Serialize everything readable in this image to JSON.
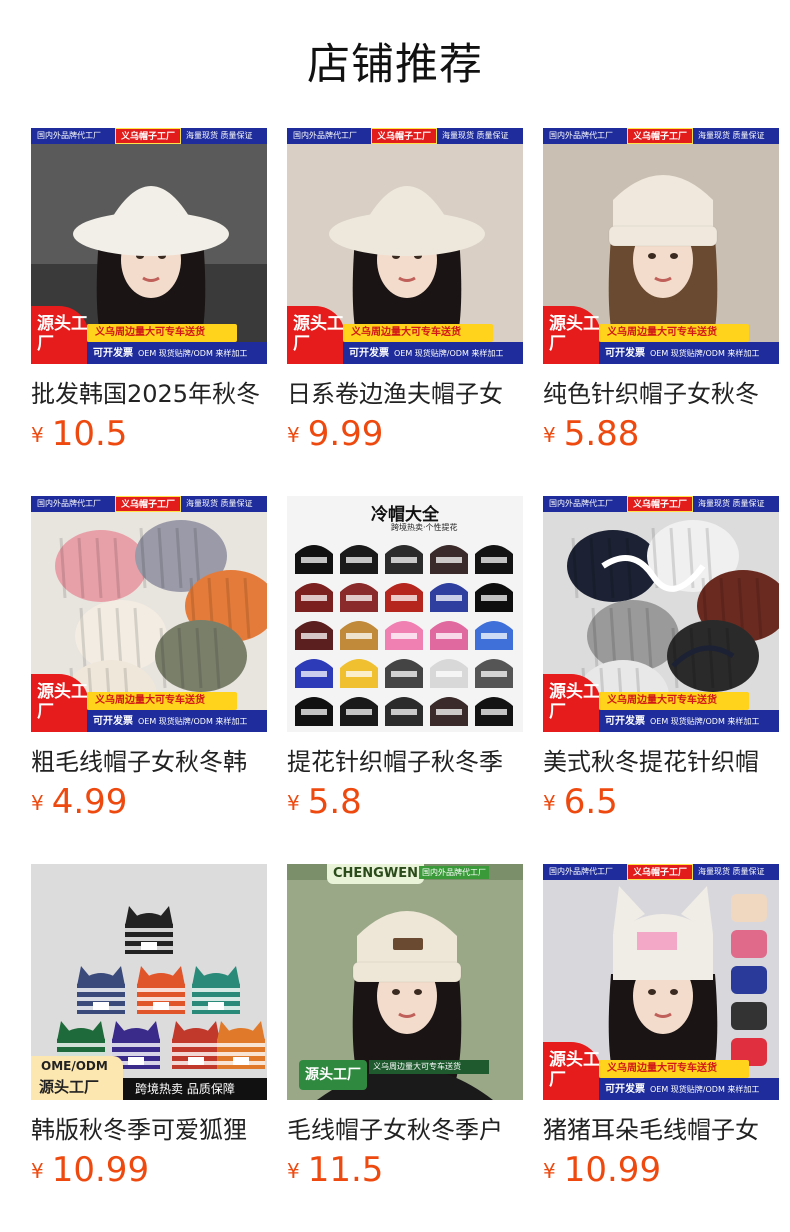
{
  "header": {
    "title": "店铺推荐"
  },
  "currency": "¥",
  "products": [
    {
      "name": "批发韩国2025年秋冬",
      "price": "10.5",
      "banner": {
        "top_left": "国内外品牌代工厂",
        "top_mid": "义乌帽子工厂",
        "top_right": "海量现货 质量保证",
        "badge": "源头工厂",
        "yellow": "义乌周边量大可专车送货",
        "blue_main": "可开发票",
        "blue_sub": "OEM 现货贴牌/ODM 来样加工"
      },
      "hat_color": "#f2efe8",
      "bg": "#3a3a3a",
      "image_icon": "white-bucket-hat-photo"
    },
    {
      "name": "日系卷边渔夫帽子女",
      "price": "9.99",
      "banner": {
        "top_left": "国内外品牌代工厂",
        "top_mid": "义乌帽子工厂",
        "top_right": "海量现货 质量保证",
        "badge": "源头工厂",
        "yellow": "义乌周边量大可专车送货",
        "blue_main": "可开发票",
        "blue_sub": "OEM 现货贴牌/ODM 来样加工"
      },
      "hat_color": "#eee8dc",
      "bg": "#d9cfc4",
      "image_icon": "fleece-bucket-hat-photo"
    },
    {
      "name": "纯色针织帽子女秋冬",
      "price": "5.88",
      "banner": {
        "top_left": "国内外品牌代工厂",
        "top_mid": "义乌帽子工厂",
        "top_right": "海量现货 质量保证",
        "badge": "源头工厂",
        "yellow": "义乌周边量大可专车送货",
        "blue_main": "可开发票",
        "blue_sub": "OEM 现货贴牌/ODM 来样加工"
      },
      "hat_color": "#f0e8dc",
      "bg": "#c9bfb2",
      "image_icon": "beanie-model-photo"
    },
    {
      "name": "粗毛线帽子女秋冬韩",
      "price": "4.99",
      "banner": {
        "top_left": "国内外品牌代工厂",
        "top_mid": "义乌帽子工厂",
        "top_right": "海量现货 质量保证",
        "badge": "源头工厂",
        "yellow": "义乌周边量大可专车送货",
        "blue_main": "可开发票",
        "blue_sub": "OEM 现货贴牌/ODM 来样加工"
      },
      "hat_color": "#e47b3a",
      "bg": "#e8e4de",
      "image_icon": "chunky-beanies-photo"
    },
    {
      "name": "提花针织帽子秋冬季",
      "price": "5.8",
      "banner": null,
      "overlay_title": "冷帽大全",
      "overlay_sub": "跨境热卖·个性提花",
      "hat_color": "#222222",
      "bg": "#f4f4f4",
      "image_icon": "jacquard-beanies-grid"
    },
    {
      "name": "美式秋冬提花针织帽",
      "price": "6.5",
      "banner": {
        "top_left": "国内外品牌代工厂",
        "top_mid": "义乌帽子工厂",
        "top_right": "海量现货 质量保证",
        "badge": "源头工厂",
        "yellow": "义乌周边量大可专车送货",
        "blue_main": "可开发票",
        "blue_sub": "OEM 现货贴牌/ODM 来样加工"
      },
      "hat_color": "#1c2233",
      "bg": "#dcdcdc",
      "image_icon": "star-beanies-photo"
    },
    {
      "name": "韩版秋冬季可爱狐狸",
      "price": "10.99",
      "banner": null,
      "overlay_title": "OME/ODM",
      "overlay_sub": "源头工厂",
      "overlay_strip": "跨境热卖 品质保障",
      "hat_color": "#1f1f1f",
      "bg": "#dcdcdc",
      "image_icon": "fox-ear-beanies-photo"
    },
    {
      "name": "毛线帽子女秋冬季户",
      "price": "11.5",
      "banner": null,
      "overlay_title": "CHENGWEN",
      "overlay_sub": "国内外品牌代工厂",
      "overlay_strip": "义乌周边量大可专车送货",
      "badge2": "源头工厂",
      "hat_color": "#eee6d6",
      "bg": "#7a8f6a",
      "image_icon": "knit-beanie-model-photo"
    },
    {
      "name": "猪猪耳朵毛线帽子女",
      "price": "10.99",
      "banner": {
        "top_left": "国内外品牌代工厂",
        "top_mid": "义乌帽子工厂",
        "top_right": "海量现货 质量保证",
        "badge": "源头工厂",
        "yellow": "义乌周边量大可专车送货",
        "blue_main": "可开发票",
        "blue_sub": "OEM 现货贴牌/ODM 来样加工"
      },
      "hat_color": "#f0ece6",
      "bg": "#d8d8dc",
      "image_icon": "cat-ear-beanie-photo"
    }
  ]
}
